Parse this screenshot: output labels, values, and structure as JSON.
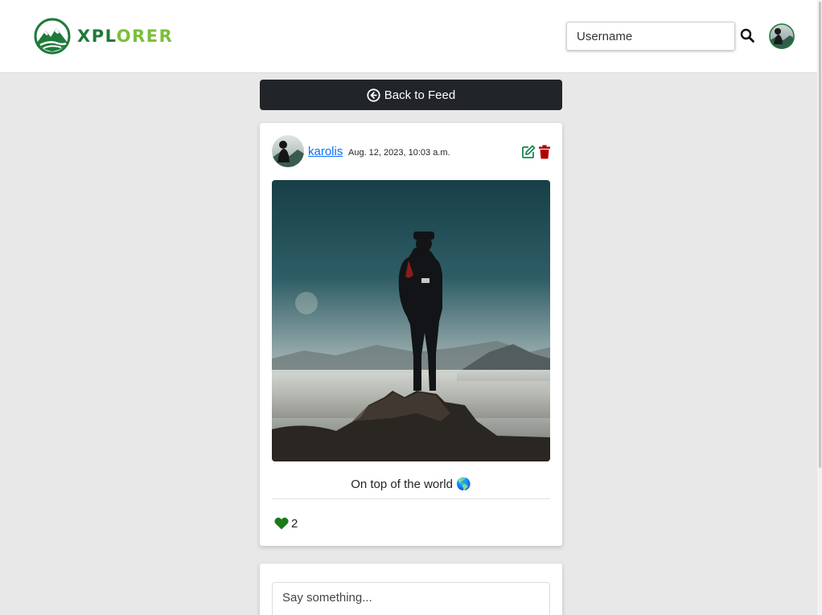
{
  "brand": {
    "name_part1": "XPL",
    "name_part2": "ORER",
    "logo_icon": "mountain-logo-icon",
    "colors": {
      "dark": "#1f7a3a",
      "light": "#7bbf3a"
    }
  },
  "navbar": {
    "search_placeholder": "Username",
    "search_icon": "search-icon",
    "avatar_icon": "user-avatar"
  },
  "back_button": {
    "label": "Back to Feed",
    "icon": "circle-arrow-left-icon"
  },
  "post": {
    "author": "karolis",
    "date": "Aug. 12, 2023, 10:03 a.m.",
    "caption": "On top of the world 🌎",
    "likes": "2",
    "icons": {
      "edit": "edit-icon",
      "delete": "trash-icon",
      "like": "heart-icon"
    },
    "colors": {
      "edit": "#198754",
      "delete": "#b00000",
      "like": "#1a7a1a",
      "link": "#0d6efd"
    }
  },
  "comment": {
    "placeholder": "Say something..."
  }
}
